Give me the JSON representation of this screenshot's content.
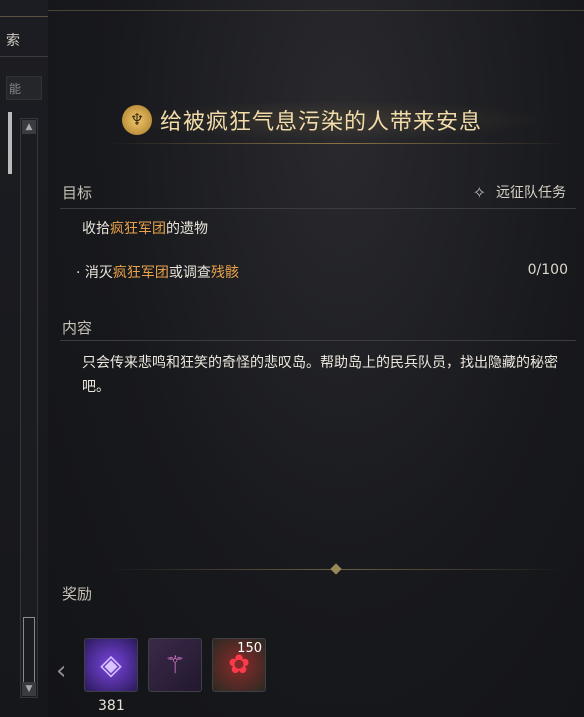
{
  "left_panel": {
    "tab_label": "索",
    "box_label": "能"
  },
  "quest": {
    "title": "给被疯狂气息污染的人带来安息",
    "icon": "quest-emblem-icon"
  },
  "objective": {
    "section_label": "目标",
    "quest_type": "远征队任务",
    "quest_type_icon": "expedition-star-icon",
    "main_prefix": "收拾",
    "main_highlight": "疯狂军团",
    "main_suffix": "的遗物",
    "sub_bullet": "·",
    "sub_prefix": "消灭",
    "sub_highlight": "疯狂军团",
    "sub_mid": "或调查",
    "sub_highlight2": "残骸",
    "progress": "0/100"
  },
  "content": {
    "section_label": "内容",
    "description": "只会传来悲鸣和狂笑的奇怪的悲叹岛。帮助岛上的民兵队员，找出隐藏的秘密吧。"
  },
  "rewards": {
    "section_label": "奖励",
    "prev_arrow": "‹",
    "items": [
      {
        "icon": "purple-crystal-icon",
        "count": "381"
      },
      {
        "icon": "rose-staff-icon",
        "count": ""
      },
      {
        "icon": "red-rose-icon",
        "count": "150"
      }
    ]
  },
  "colors": {
    "highlight": "#e9a24a",
    "title": "#f1dcaa"
  }
}
